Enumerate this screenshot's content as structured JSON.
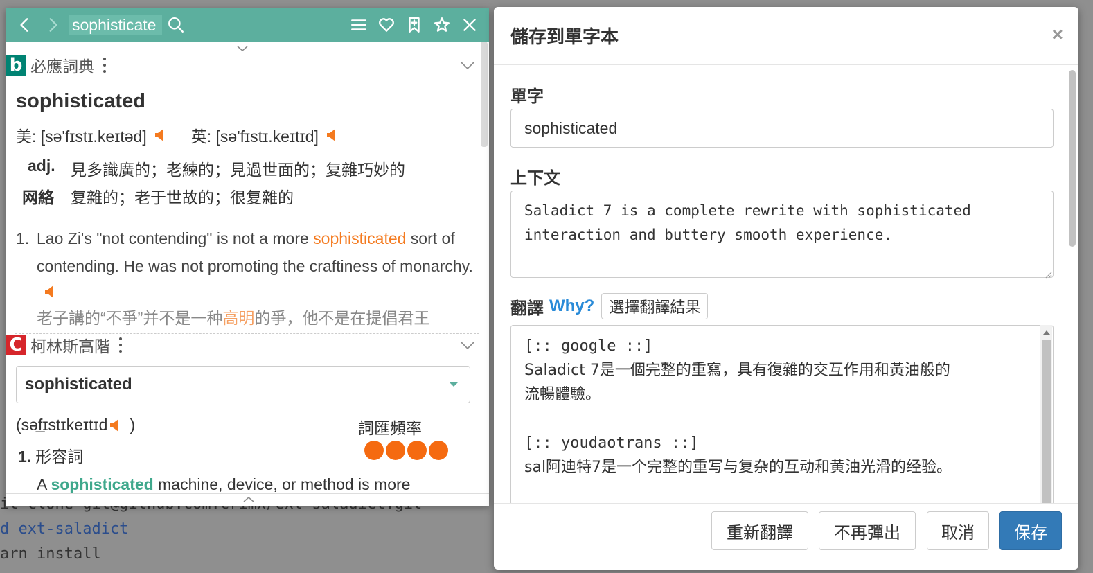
{
  "background": {
    "terminal_lines": [
      "git clone git@github.com:crimx/ext-saladict.git",
      "cd ext-saladict",
      "yarn install"
    ],
    "terminal_visible": [
      "it clone git@github.com:crimx/ext-saladict.git",
      "d ext-saladict",
      "arn install"
    ]
  },
  "dict": {
    "accent_color": "#5caf9e",
    "search_value": "sophisticate",
    "icons": [
      "chevron-left-icon",
      "chevron-right-icon",
      "search-icon",
      "menu-icon",
      "heart-icon",
      "bookmark-icon",
      "pin-icon",
      "close-icon"
    ],
    "bing": {
      "name": "必應詞典",
      "logo": "b",
      "headword": "sophisticated",
      "phon_us": "美: [sə'fɪstɪ.keɪtəd]",
      "phon_uk": "英: [sə'fɪstɪ.keɪtɪd]",
      "defs": [
        {
          "pos": "adj.",
          "text": "見多識廣的；老練的；見過世面的；复雜巧妙的"
        },
        {
          "pos": "网絡",
          "text": "复雜的；老于世故的；很复雜的"
        }
      ],
      "example": {
        "num": "1.",
        "before": "Lao Zi's \"not contending\" is not a more ",
        "highlight": "sophisticated",
        "after": " sort of contending. He was not promoting the craftiness of monarchy.",
        "zh_before": "老子講的“不爭”并不是一种",
        "zh_highlight": "高明",
        "zh_after": "的爭，他不是在提倡君王"
      }
    },
    "collins": {
      "name": "柯林斯高階",
      "logo": "C",
      "selected": "sophisticated",
      "phon": "(səf̲ɪstɪkeɪtɪd",
      "phon_close": ")",
      "freq_label": "詞匯頻率",
      "freq_level": 4,
      "sense_num": "1.",
      "sense_pos": "形容詞",
      "def_before": "A ",
      "def_highlight": "sophisticated",
      "def_after": " machine, device, or method is more"
    }
  },
  "modal": {
    "title": "儲存到單字本",
    "close": "×",
    "word_label": "單字",
    "word_value": "sophisticated",
    "context_label": "上下文",
    "context_value": "Saladict 7 is a complete rewrite with sophisticated interaction and buttery smooth experience.",
    "translate_label": "翻譯",
    "why_label": "Why?",
    "choose_label": "選擇翻譯結果",
    "translation": {
      "google_tag": "[:: google ::]",
      "google_line1": "Saladict 7是一個完整的重寫，具有復雜的交互作用和黃油般的",
      "google_line2": "流暢體驗。",
      "youdao_tag": "[:: youdaotrans ::]",
      "youdao_line1": "sal阿迪特7是一个完整的重写与复杂的互动和黄油光滑的经验。"
    },
    "buttons": {
      "retranslate": "重新翻譯",
      "no_popup": "不再彈出",
      "cancel": "取消",
      "save": "保存"
    },
    "primary_color": "#337ab7"
  }
}
